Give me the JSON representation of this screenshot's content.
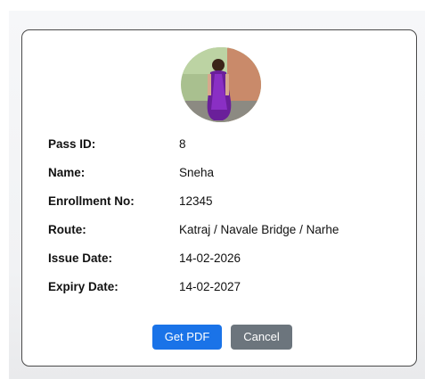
{
  "profile": {
    "photo_icon": "person-photo-icon"
  },
  "details": [
    {
      "label": "Pass ID:",
      "value": "8"
    },
    {
      "label": "Name:",
      "value": "Sneha"
    },
    {
      "label": "Enrollment No:",
      "value": "12345"
    },
    {
      "label": "Route:",
      "value": "Katraj / Navale Bridge / Narhe"
    },
    {
      "label": "Issue Date:",
      "value": "14-02-2026"
    },
    {
      "label": "Expiry Date:",
      "value": "14-02-2027"
    }
  ],
  "actions": {
    "get_pdf_label": "Get PDF",
    "cancel_label": "Cancel"
  },
  "colors": {
    "primary_button": "#1a73e8",
    "secondary_button": "#6c757d",
    "card_border": "#4a4a4a"
  }
}
